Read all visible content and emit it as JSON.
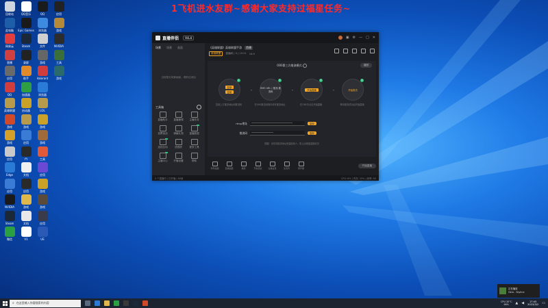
{
  "headline": "1飞机进水友群~感谢大家支持过福星任务~",
  "desktop_icons": [
    {
      "label": "回收站",
      "color": "#d0d6de"
    },
    {
      "label": "QQ音乐",
      "color": "#ffffff"
    },
    {
      "label": "QQ",
      "color": "#1b1b1b"
    },
    {
      "label": "应用",
      "color": "#222222"
    },
    {
      "label": "此电脑",
      "color": "#1d5ea8"
    },
    {
      "label": "Epic Games",
      "color": "#1a1a1a"
    },
    {
      "label": "浏览器",
      "color": "#3d8be0"
    },
    {
      "label": "游戏",
      "color": "#b48a3a"
    },
    {
      "label": "网易云",
      "color": "#e23c3c"
    },
    {
      "label": "Steam",
      "color": "#1b2838"
    },
    {
      "label": "文件",
      "color": "#cfcfcf"
    },
    {
      "label": "NVIDIA",
      "color": "#2c2c2c"
    },
    {
      "label": "直播",
      "color": "#d04040"
    },
    {
      "label": "录屏",
      "color": "#222222"
    },
    {
      "label": "游戏",
      "color": "#666666"
    },
    {
      "label": "工具",
      "color": "#3a6e3a"
    },
    {
      "label": "应用",
      "color": "#6a6a6a"
    },
    {
      "label": "助手",
      "color": "#e08a2a"
    },
    {
      "label": "Valorant",
      "color": "#d13c3c"
    },
    {
      "label": "游戏",
      "color": "#2a6a6a"
    },
    {
      "label": "QQ",
      "color": "#d13c3c"
    },
    {
      "label": "加速器",
      "color": "#2ea043"
    },
    {
      "label": "浏览器",
      "color": "#2b7bd9"
    },
    {
      "label": "英雄联盟",
      "color": "#b89b4a"
    },
    {
      "label": "启动器",
      "color": "#c9a227"
    },
    {
      "label": "LOL",
      "color": "#b89b4a"
    },
    {
      "label": "游戏",
      "color": "#d04a2a"
    },
    {
      "label": "游戏",
      "color": "#b89b4a"
    },
    {
      "label": "游戏",
      "color": "#c9a227"
    },
    {
      "label": "游戏",
      "color": "#d4a02a"
    },
    {
      "label": "应用",
      "color": "#3a7bd5"
    },
    {
      "label": "游戏",
      "color": "#a06a3a"
    },
    {
      "label": "应用",
      "color": "#c9c9c9"
    },
    {
      "label": "YY",
      "color": "#2a2a2a"
    },
    {
      "label": "工具",
      "color": "#e05a3a"
    },
    {
      "label": "Edge",
      "color": "#2a7bd5"
    },
    {
      "label": "文档",
      "color": "#f0f0f0"
    },
    {
      "label": "应用",
      "color": "#6a4ad5"
    },
    {
      "label": "应用",
      "color": "#3a7bd5"
    },
    {
      "label": "应用",
      "color": "#2a2a2a"
    },
    {
      "label": "游戏",
      "color": "#c9a227"
    },
    {
      "label": "NVIDIA",
      "color": "#1a1a1a"
    },
    {
      "label": "游戏",
      "color": "#e0b84a"
    },
    {
      "label": "游戏",
      "color": "#5a4a3a"
    },
    {
      "label": "Steam",
      "color": "#1b2838"
    },
    {
      "label": "文档",
      "color": "#e8e8e8"
    },
    {
      "label": "应用",
      "color": "#3a3a4a"
    },
    {
      "label": "微信",
      "color": "#2aa043"
    },
    {
      "label": "V1",
      "color": "#ffffff"
    },
    {
      "label": "UE",
      "color": "#2a5ab5"
    }
  ],
  "app": {
    "logo_text": "直播伴侣",
    "version": "V4.4",
    "side_tabs": [
      "场景",
      "场景",
      "画面"
    ],
    "side_empty": "当前暂无场景画面，请前往添加",
    "tools_header": "工具箱",
    "tools": [
      {
        "label": "直播助手",
        "hl": false
      },
      {
        "label": "直播管理",
        "hl": false
      },
      {
        "label": "主播任务",
        "hl": false
      },
      {
        "label": "投票挑战",
        "hl": false
      },
      {
        "label": "弹幕礼物",
        "hl": false
      },
      {
        "label": "直播数据",
        "hl": true
      },
      {
        "label": "连线互动",
        "hl": true
      },
      {
        "label": "语音房",
        "hl": false
      },
      {
        "label": "更多工具",
        "hl": false
      },
      {
        "label": "主播中心",
        "hl": true
      },
      {
        "label": "开播设置",
        "hl": false
      },
      {
        "label": "帮助",
        "hl": false
      }
    ],
    "room_title": "《英雄联盟》英雄联盟手游",
    "room_tag": "首播",
    "room_category": "英雄联盟",
    "room_info": "直播间 | 0 | 10:21",
    "room_viewers": "16:9",
    "mode_title": "OBS第三方推流模式",
    "back_label": "返回",
    "steps": [
      {
        "num": "1",
        "top_btn": "复制",
        "text": "",
        "bottom_btn": "复制",
        "label": "复制上方推流地址和推流码"
      },
      {
        "num": "2",
        "top_btn": "",
        "text": "RMS URL | 推流:推流码",
        "bottom_btn": "",
        "label": "在OBS推流设置中填写推流地址"
      },
      {
        "num": "3",
        "top_btn": "",
        "text": "",
        "bottom_btn": "开始直播",
        "label": "在OBS中点击开始直播"
      },
      {
        "num": "4",
        "top_btn": "",
        "text": "开始推流",
        "bottom_btn": "",
        "label": "等待推流成功后开始直播"
      }
    ],
    "fields": [
      {
        "label": "rtmp地址",
        "value": "••••••••••••••••••••••••••••••",
        "copy": "复制"
      },
      {
        "label": "推流码",
        "value": "••••••••••••••••",
        "copy": "复制"
      }
    ],
    "hint": "提醒：请勿将推流地址泄露给他人，防止出现被盗播情况",
    "toolbar": [
      "场景画面",
      "直播画面",
      "美颜",
      "开启连麦",
      "主播设置",
      "麦克风",
      "扬声器"
    ],
    "start_btn": "开始直播",
    "status_left": "0 个直播中 | 已开播 | 60帧",
    "status_right": "CPU: 6% | 内存: 33% | 帧率: 60"
  },
  "notification": {
    "line1": "正在播放",
    "line2": "Hero - Skyline"
  },
  "taskbar": {
    "search_text": "在这里输入你要搜索的内容",
    "tray": "CPU 30°C",
    "tray2": "68%",
    "time": "17:45",
    "date": "2023/3/2"
  }
}
